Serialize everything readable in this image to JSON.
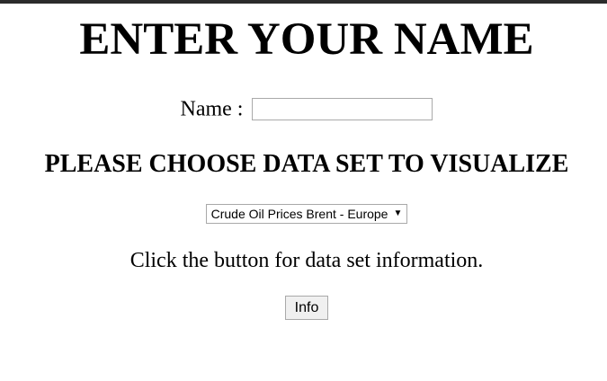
{
  "header": {
    "title": "ENTER YOUR NAME"
  },
  "name_field": {
    "label": "Name :",
    "value": "",
    "placeholder": ""
  },
  "dataset": {
    "heading": "PLEASE CHOOSE DATA SET TO VISUALIZE",
    "selected": "Crude Oil Prices Brent - Europe",
    "arrow_glyph": "▼"
  },
  "info": {
    "instruction": "Click the button for data set information.",
    "button_label": "Info"
  },
  "colors": {
    "top_border": "#2b2b2b",
    "control_border": "#a9a9a9",
    "button_bg": "#f0f0f0"
  }
}
